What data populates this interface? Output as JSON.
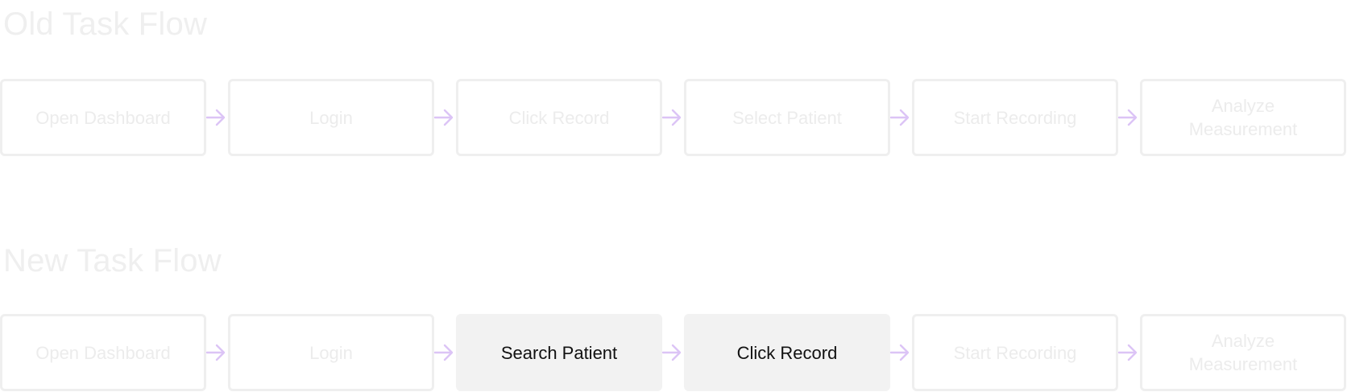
{
  "old_flow": {
    "title": "Old Task Flow",
    "steps": [
      {
        "label": "Open Dashboard",
        "highlighted": false
      },
      {
        "label": "Login",
        "highlighted": false
      },
      {
        "label": "Click Record",
        "highlighted": false
      },
      {
        "label": "Select Patient",
        "highlighted": false
      },
      {
        "label": "Start Recording",
        "highlighted": false
      },
      {
        "label": "Analyze Measurement",
        "highlighted": false
      }
    ]
  },
  "new_flow": {
    "title": "New Task Flow",
    "steps": [
      {
        "label": "Open Dashboard",
        "highlighted": false
      },
      {
        "label": "Login",
        "highlighted": false
      },
      {
        "label": "Search Patient",
        "highlighted": true
      },
      {
        "label": "Click Record",
        "highlighted": true
      },
      {
        "label": "Start Recording",
        "highlighted": false
      },
      {
        "label": "Analyze Measurement",
        "highlighted": false
      }
    ]
  },
  "colors": {
    "arrow": "#dcc4f6",
    "faded_text": "#ececec",
    "box_border": "#efefef",
    "highlight_fill": "#f2f2f2",
    "highlight_text": "#111111"
  },
  "icons": {
    "connector": "arrow-right-icon"
  }
}
